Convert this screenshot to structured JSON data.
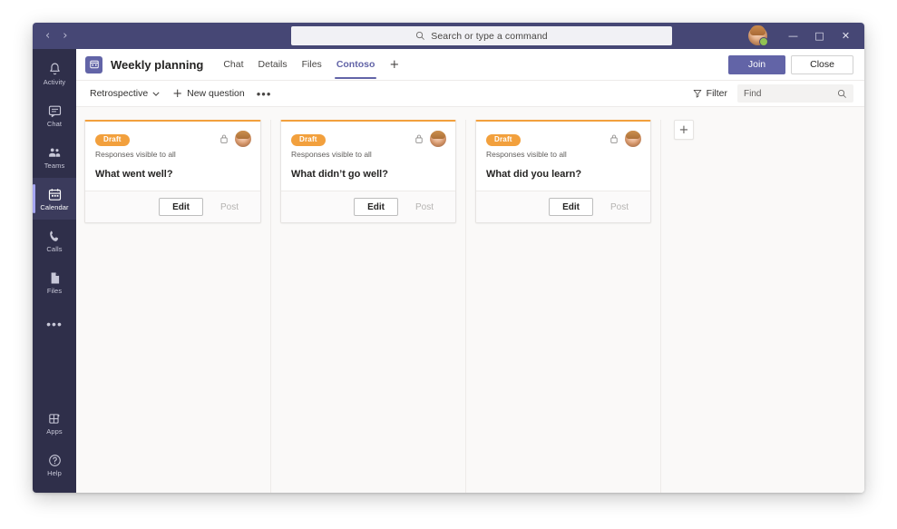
{
  "titlebar": {
    "back_icon": "chevron-left-icon",
    "forward_icon": "chevron-right-icon",
    "back_glyph": "‹",
    "forward_glyph": "›",
    "search_placeholder": "Search or type a command",
    "search_icon": "search-icon",
    "avatar": "user-avatar",
    "presence": "available",
    "minimize_glyph": "—",
    "maximize_glyph": "□",
    "close_glyph": "✕",
    "bg_color": "#464775"
  },
  "rail": {
    "items": [
      {
        "label": "Activity",
        "icon": "bell-icon",
        "active": false
      },
      {
        "label": "Chat",
        "icon": "chat-icon",
        "active": false
      },
      {
        "label": "Teams",
        "icon": "teams-icon",
        "active": false
      },
      {
        "label": "Calendar",
        "icon": "calendar-icon",
        "active": true
      },
      {
        "label": "Calls",
        "icon": "phone-icon",
        "active": false
      },
      {
        "label": "Files",
        "icon": "files-icon",
        "active": false
      }
    ],
    "more_glyph": "•••",
    "more_icon": "more-options-icon",
    "bottom_items": [
      {
        "label": "Apps",
        "icon": "apps-icon"
      },
      {
        "label": "Help",
        "icon": "help-icon"
      }
    ],
    "bg_color": "#2f2f4a"
  },
  "header": {
    "app_icon": "app-grid-icon",
    "title": "Weekly planning",
    "tabs": [
      {
        "label": "Chat",
        "active": false
      },
      {
        "label": "Details",
        "active": false
      },
      {
        "label": "Files",
        "active": false
      },
      {
        "label": "Contoso",
        "active": true
      }
    ],
    "add_tab_glyph": "+",
    "add_tab_icon": "add-tab-icon",
    "join_label": "Join",
    "close_label": "Close",
    "accent_color": "#6264a7"
  },
  "toolbar": {
    "view_label": "Retrospective",
    "view_chevron": "⌄",
    "new_question_label": "New question",
    "new_question_glyph": "+",
    "more_glyph": "•••",
    "filter_label": "Filter",
    "filter_icon": "filter-icon",
    "find_placeholder": "Find",
    "find_icon": "search-icon"
  },
  "board": {
    "cards": [
      {
        "badge": "Draft",
        "visibility": "Responses visible to all",
        "question": "What went well?",
        "lock_icon": "lock-icon",
        "avatar": "author-avatar",
        "edit_label": "Edit",
        "post_label": "Post"
      },
      {
        "badge": "Draft",
        "visibility": "Responses visible to all",
        "question": "What didn’t go well?",
        "lock_icon": "lock-icon",
        "avatar": "author-avatar",
        "edit_label": "Edit",
        "post_label": "Post"
      },
      {
        "badge": "Draft",
        "visibility": "Responses visible to all",
        "question": "What did you learn?",
        "lock_icon": "lock-icon",
        "avatar": "author-avatar",
        "edit_label": "Edit",
        "post_label": "Post"
      }
    ],
    "add_column_glyph": "+",
    "add_column_icon": "add-card-icon",
    "draft_color": "#f2a03d",
    "bg_color": "#faf9f8"
  }
}
